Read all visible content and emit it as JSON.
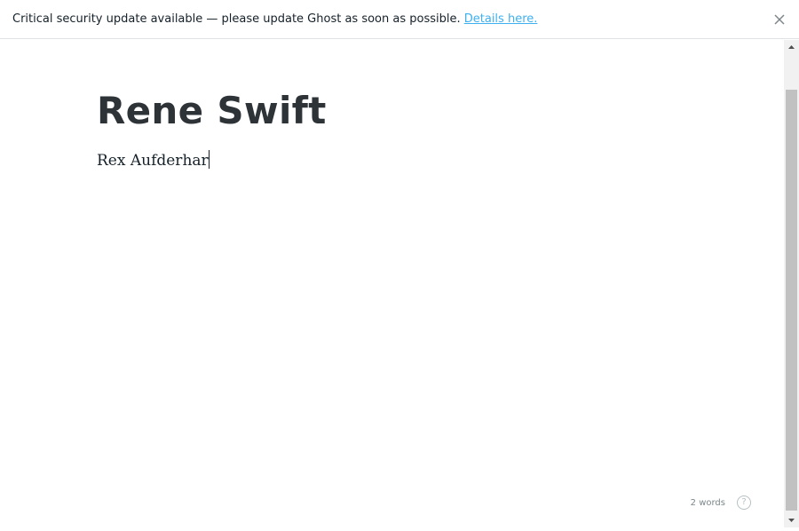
{
  "banner": {
    "message": "Critical security update available — please update Ghost as soon as possible. ",
    "link_label": "Details here.",
    "close_icon": "close-icon"
  },
  "editor": {
    "title": "Rene Swift",
    "body": "Rex Aufderhar",
    "word_count": "2 words",
    "help_label": "?"
  },
  "colors": {
    "link": "#3eb0ef",
    "title": "#2e3338",
    "text": "#15212a",
    "muted": "#7d878a"
  }
}
